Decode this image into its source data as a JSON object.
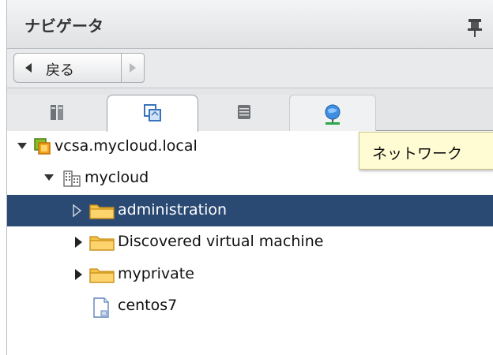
{
  "header": {
    "title": "ナビゲータ",
    "pin_icon": "pin-icon"
  },
  "toolbar": {
    "back_label": "戻る",
    "back_icon": "triangle-left-icon",
    "forward_icon": "triangle-right-icon"
  },
  "tabs": [
    {
      "icon": "hosts-clusters-icon",
      "active": false
    },
    {
      "icon": "vms-templates-icon",
      "active": true
    },
    {
      "icon": "storage-icon",
      "active": false
    },
    {
      "icon": "networking-icon",
      "active": false
    }
  ],
  "tooltip": {
    "text": "ネットワーク"
  },
  "tree": {
    "nodes": [
      {
        "label": "vcsa.mycloud.local",
        "icon": "vcenter-icon",
        "expanded": true,
        "level": 0
      },
      {
        "label": "mycloud",
        "icon": "datacenter-icon",
        "expanded": true,
        "level": 1
      },
      {
        "label": "administration",
        "icon": "folder-icon",
        "expanded": false,
        "selected": true,
        "level": 2
      },
      {
        "label": "Discovered virtual machine",
        "icon": "folder-icon",
        "expanded": false,
        "level": 2
      },
      {
        "label": "myprivate",
        "icon": "folder-icon",
        "expanded": false,
        "level": 2
      },
      {
        "label": "centos7",
        "icon": "vm-icon",
        "level": 2
      }
    ]
  },
  "colors": {
    "selection": "#2b4a73",
    "tooltip_bg": "#fffbd2",
    "folder": "#f6c24a"
  }
}
